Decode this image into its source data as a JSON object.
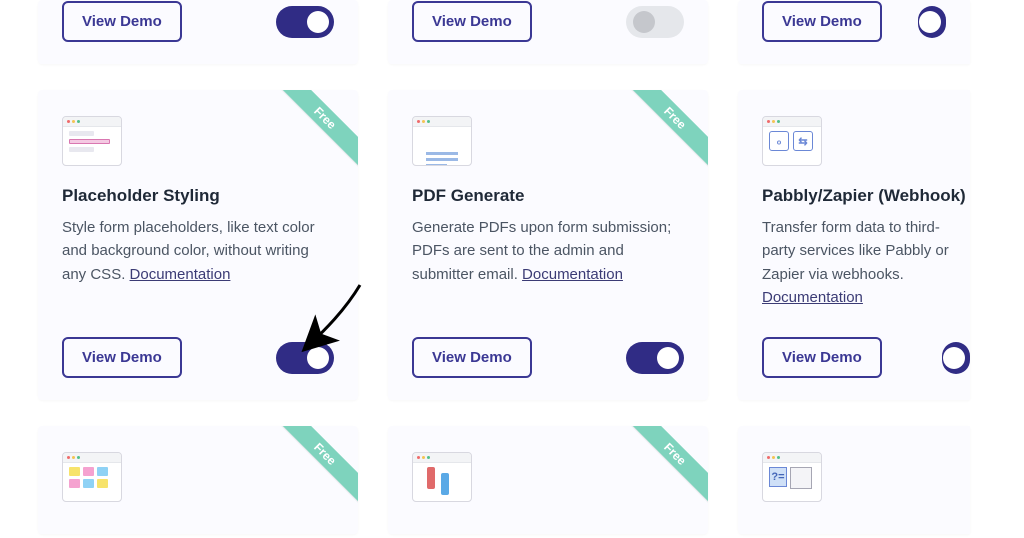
{
  "ribbon_label": "Free",
  "view_demo_label": "View Demo",
  "doc_link_label": "Documentation",
  "top_row": [
    {
      "toggle_on": true,
      "toggle_disabled": false
    },
    {
      "toggle_on": false,
      "toggle_disabled": true
    },
    {
      "toggle_on": true,
      "toggle_disabled": false,
      "clipped": true
    }
  ],
  "cards": [
    {
      "id": "placeholder-styling",
      "title": "Placeholder Styling",
      "desc_pre": "Style form placeholders, like text color and background color, without writing any CSS. ",
      "free": true,
      "toggle_on": true,
      "arrow_annotation": true
    },
    {
      "id": "pdf-generate",
      "title": "PDF Generate",
      "desc_pre": "Generate PDFs upon form submission; PDFs are sent to the admin and submitter email. ",
      "free": true,
      "toggle_on": true
    },
    {
      "id": "pabbly-zapier-webhook",
      "title": "Pabbly/Zapier (Webhook)",
      "desc_pre": "Transfer form data to third-party services like Pabbly or Zapier via webhooks. ",
      "free": false,
      "toggle_on": true,
      "clipped": true
    }
  ],
  "bottom_row": [
    {
      "free": true
    },
    {
      "free": true
    },
    {
      "free": false
    }
  ]
}
